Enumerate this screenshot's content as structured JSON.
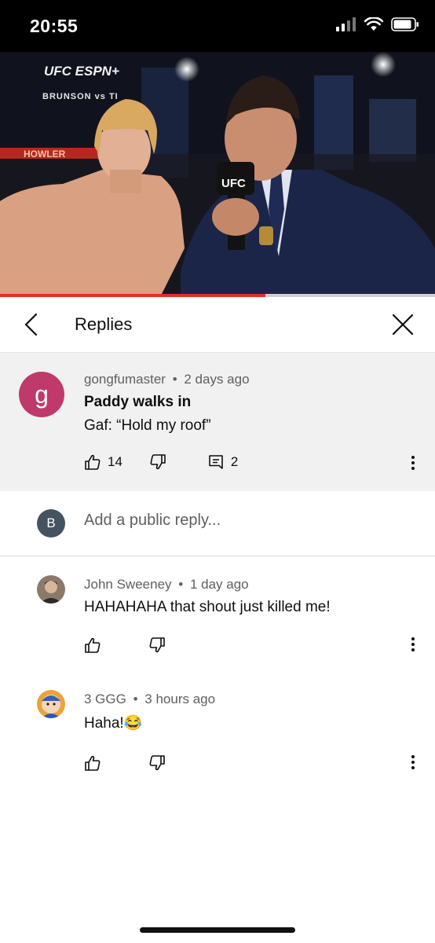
{
  "status_bar": {
    "time": "20:55"
  },
  "video": {
    "progress_fraction": 0.61,
    "overlay": {
      "logo": "UFC ESPN+",
      "brunson_text": "BRUNSON vs TI",
      "mic_text": "UFC",
      "howler_text": "HOWLER"
    }
  },
  "header": {
    "title": "Replies"
  },
  "parent_comment": {
    "author": "gongfumaster",
    "time": "2 days ago",
    "avatar_letter": "g",
    "title": "Paddy walks in",
    "text": "Gaf: “Hold my roof”",
    "likes": "14",
    "replies": "2"
  },
  "reply_input": {
    "avatar_letter": "B",
    "placeholder": "Add a public reply..."
  },
  "replies": [
    {
      "author": "John Sweeney",
      "time": "1 day ago",
      "text": "HAHAHAHA that shout just killed me!"
    },
    {
      "author": "3 GGG",
      "time": "3 hours ago",
      "text": "Haha!😂"
    }
  ],
  "meta_separator": "•",
  "colors": {
    "accent_red": "#e52d27",
    "avatar_g": "#c0396b",
    "avatar_b": "#44535f",
    "comment_bg": "#f1f1f1"
  }
}
